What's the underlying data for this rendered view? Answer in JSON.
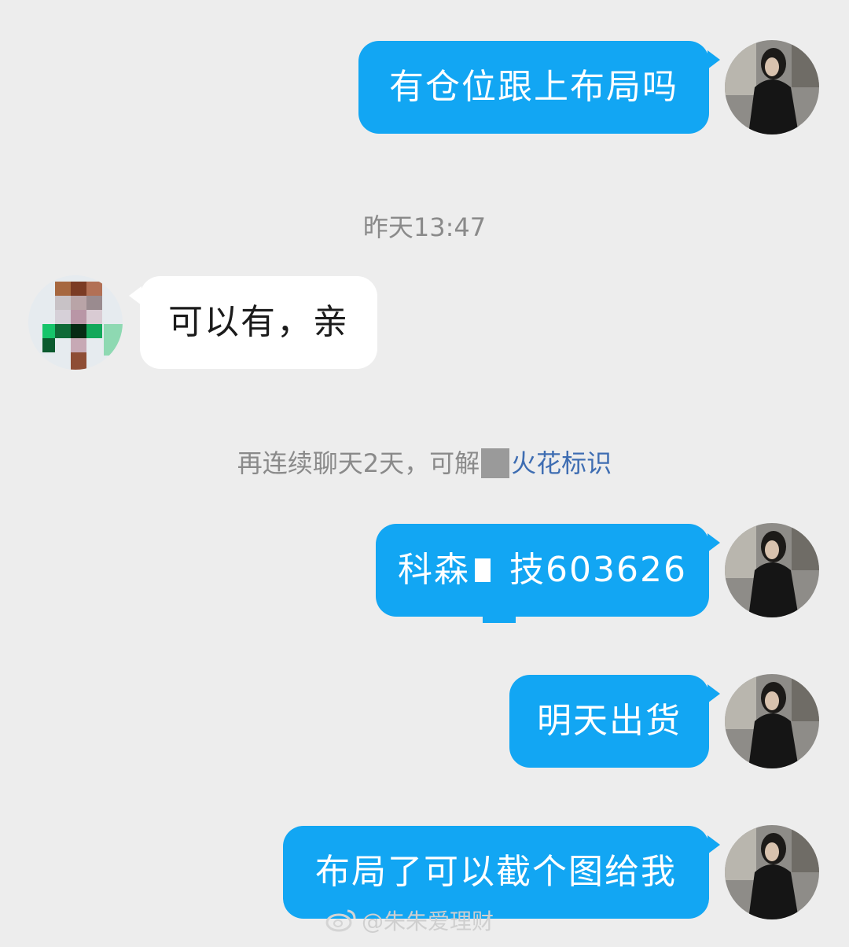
{
  "messages": [
    {
      "side": "out",
      "text": "有仓位跟上布局吗"
    },
    {
      "timestamp": "昨天13:47"
    },
    {
      "side": "in",
      "text": "可以有，亲"
    },
    {
      "system": {
        "prefix": "再连续聊天2天，可解",
        "link": "火花标识"
      }
    },
    {
      "side": "out",
      "text_part1": "科森",
      "text_part2": "技603626"
    },
    {
      "side": "out",
      "text": "明天出货"
    },
    {
      "side": "out",
      "text": "布局了可以截个图给我"
    }
  ],
  "watermark": "@朱朱爱理财",
  "colors": {
    "outgoing_bubble": "#12a6f3",
    "incoming_bubble": "#ffffff",
    "background": "#ededed",
    "link": "#3e6db2"
  }
}
